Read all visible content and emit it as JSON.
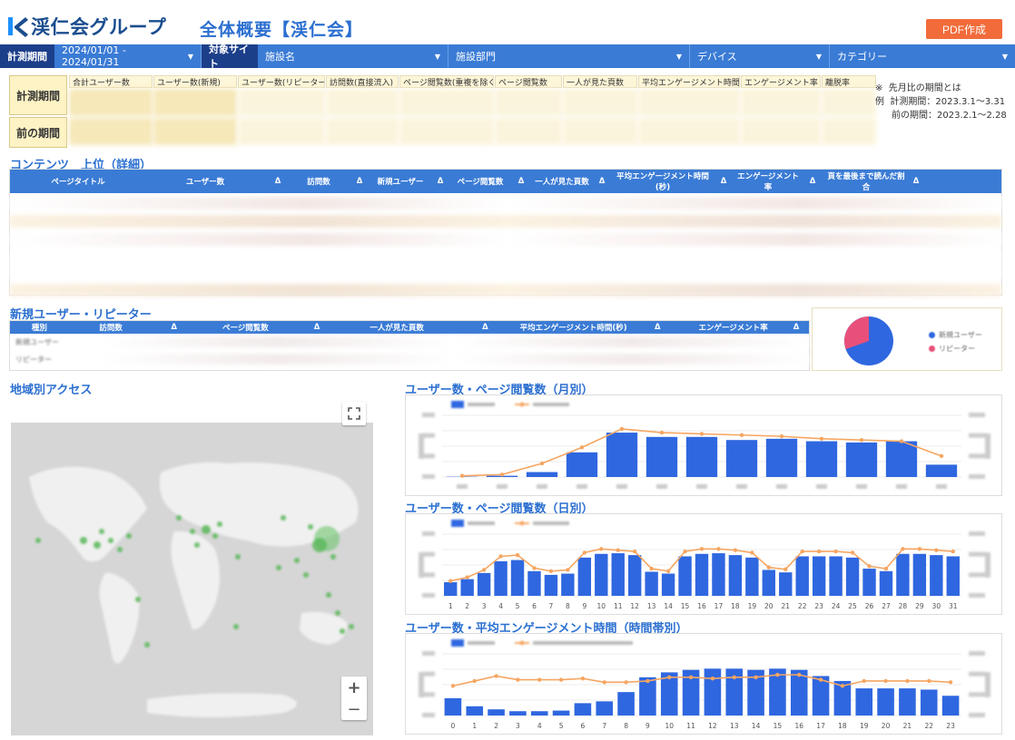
{
  "header": {
    "logo_text": "渓仁会グループ",
    "page_title": "全体概要【渓仁会】",
    "pdf_button": "PDF作成"
  },
  "filters": {
    "period_label": "計測期間",
    "period_value": "2024/01/01 - 2024/01/31",
    "site_label": "対象サイト",
    "facility_name": "施設名",
    "facility_department": "施設部門",
    "device": "デバイス",
    "category": "カテゴリー"
  },
  "kpi": {
    "row_current": "計測期間",
    "row_previous": "前の期間",
    "columns": [
      "合計ユーザー数",
      "ユーザー数(新規)",
      "ユーザー数(リピーター)",
      "訪問数(直接流入)",
      "ページ閲覧数(重複を除く)",
      "ページ閲覧数",
      "一人が見た頁数",
      "平均エンゲージメント時間",
      "エンゲージメント率",
      "離脱率"
    ]
  },
  "note": {
    "mark": "※",
    "example": "例",
    "line1": "先月比の期間とは",
    "line2": "計測期間：2023.3.1～3.31",
    "line3": "前の期間：2023.2.1～2.28"
  },
  "contents": {
    "title": "コンテンツ　上位（詳細）",
    "headers": [
      "ページタイトル",
      "ユーザー数",
      "Δ",
      "訪問数",
      "Δ",
      "新規ユーザー",
      "Δ",
      "ページ閲覧数",
      "Δ",
      "一人が見た頁数",
      "Δ",
      "平均エンゲージメント時間(秒)",
      "Δ",
      "エンゲージメント率",
      "Δ",
      "頁を最後まで読んだ割合",
      "Δ"
    ]
  },
  "newrep": {
    "title": "新規ユーザー・リピーター",
    "headers": [
      "種別",
      "訪問数",
      "Δ",
      "ページ閲覧数",
      "Δ",
      "一人が見た頁数",
      "Δ",
      "平均エンゲージメント時間(秒)",
      "Δ",
      "エンゲージメント率",
      "Δ"
    ],
    "rows": [
      "新規ユーザー",
      "リピーター"
    ],
    "pie_legend": [
      "新規ユーザー",
      "リピーター"
    ]
  },
  "region": {
    "title": "地域別アクセス",
    "zoom_in": "+",
    "zoom_out": "−"
  },
  "chart_monthly": {
    "title": "ユーザー数・ページ閲覧数（月別）"
  },
  "chart_daily": {
    "title": "ユーザー数・ページ閲覧数（日別）",
    "days": [
      "1",
      "2",
      "3",
      "4",
      "5",
      "6",
      "7",
      "8",
      "9",
      "10",
      "11",
      "12",
      "13",
      "14",
      "15",
      "16",
      "17",
      "18",
      "19",
      "20",
      "21",
      "22",
      "23",
      "24",
      "25",
      "26",
      "27",
      "28",
      "29",
      "30",
      "31"
    ]
  },
  "chart_hourly": {
    "title": "ユーザー数・平均エンゲージメント時間（時間帯別）",
    "hours": [
      "0",
      "1",
      "2",
      "3",
      "4",
      "5",
      "6",
      "7",
      "8",
      "9",
      "10",
      "11",
      "12",
      "13",
      "14",
      "15",
      "16",
      "17",
      "18",
      "19",
      "20",
      "21",
      "22",
      "23"
    ]
  },
  "chart_data": [
    {
      "type": "bar",
      "title": "",
      "categories": [
        "",
        "",
        "",
        "",
        "",
        "",
        "",
        "",
        "",
        "",
        "",
        "",
        ""
      ],
      "series": [
        {
          "values": [
            0.5,
            2,
            8,
            40,
            72,
            65,
            65,
            60,
            62,
            58,
            56,
            58,
            20
          ]
        },
        {
          "values": [
            2,
            4,
            22,
            48,
            78,
            72,
            70,
            68,
            66,
            62,
            60,
            58,
            34
          ]
        }
      ],
      "ylim": [
        0,
        100
      ],
      "colors": [
        "#2f67e0",
        "#f5a662"
      ]
    },
    {
      "type": "bar",
      "title": "",
      "categories": [
        "1",
        "2",
        "3",
        "4",
        "5",
        "6",
        "7",
        "8",
        "9",
        "10",
        "11",
        "12",
        "13",
        "14",
        "15",
        "16",
        "17",
        "18",
        "19",
        "20",
        "21",
        "22",
        "23",
        "24",
        "25",
        "26",
        "27",
        "28",
        "29",
        "30",
        "31"
      ],
      "series": [
        {
          "values": [
            22,
            27,
            37,
            56,
            58,
            40,
            34,
            36,
            62,
            68,
            69,
            66,
            39,
            36,
            64,
            68,
            69,
            66,
            62,
            42,
            38,
            64,
            64,
            64,
            62,
            44,
            40,
            68,
            68,
            66,
            64
          ]
        },
        {
          "values": [
            24,
            30,
            42,
            64,
            66,
            45,
            40,
            42,
            70,
            76,
            74,
            72,
            44,
            40,
            72,
            76,
            76,
            74,
            70,
            46,
            43,
            72,
            72,
            72,
            70,
            48,
            44,
            76,
            76,
            74,
            72
          ]
        }
      ],
      "ylim": [
        0,
        100
      ],
      "colors": [
        "#2f67e0",
        "#f5a662"
      ]
    },
    {
      "type": "bar",
      "title": "",
      "categories": [
        "0",
        "1",
        "2",
        "3",
        "4",
        "5",
        "6",
        "7",
        "8",
        "9",
        "10",
        "11",
        "12",
        "13",
        "14",
        "15",
        "16",
        "17",
        "18",
        "19",
        "20",
        "21",
        "22",
        "23"
      ],
      "series": [
        {
          "values": [
            28,
            15,
            10,
            7,
            7,
            8,
            20,
            23,
            38,
            62,
            70,
            74,
            76,
            76,
            74,
            76,
            74,
            64,
            56,
            44,
            44,
            44,
            42,
            32
          ]
        },
        {
          "values": [
            48,
            56,
            64,
            58,
            58,
            58,
            60,
            54,
            54,
            56,
            62,
            62,
            60,
            62,
            62,
            66,
            66,
            58,
            48,
            56,
            56,
            56,
            56,
            54
          ]
        }
      ],
      "ylim": [
        0,
        100
      ],
      "colors": [
        "#2f67e0",
        "#f5a662"
      ]
    }
  ]
}
